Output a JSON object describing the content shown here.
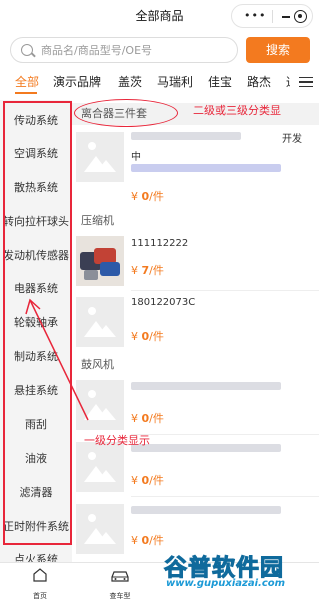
{
  "header": {
    "title": "全部商品"
  },
  "search": {
    "placeholder": "商品名/商品型号/OE号",
    "button_label": "搜索"
  },
  "tabs": [
    {
      "label": "全部",
      "active": true
    },
    {
      "label": "演示品牌"
    },
    {
      "label": "盖茨"
    },
    {
      "label": "马瑞利"
    },
    {
      "label": "佳宝"
    },
    {
      "label": "路杰"
    },
    {
      "label": "通"
    }
  ],
  "sidebar": {
    "items": [
      {
        "label": "传动系统"
      },
      {
        "label": "空调系统"
      },
      {
        "label": "散热系统"
      },
      {
        "label": "转向拉杆球头"
      },
      {
        "label": "发动机传感器"
      },
      {
        "label": "电器系统"
      },
      {
        "label": "轮毂轴承"
      },
      {
        "label": "制动系统"
      },
      {
        "label": "悬挂系统"
      },
      {
        "label": "雨刮"
      },
      {
        "label": "油液"
      },
      {
        "label": "滤清器"
      },
      {
        "label": "正时附件系统"
      },
      {
        "label": "点火系统"
      }
    ]
  },
  "content": {
    "groups": [
      {
        "title": "离合器三件套",
        "products": [
          {
            "title_tail": "开发",
            "title_line2": "中",
            "price": "0",
            "unit": "/件"
          }
        ]
      },
      {
        "title": "压缩机",
        "products": [
          {
            "title": "111112222",
            "price": "7",
            "unit": "/件"
          },
          {
            "title": "180122073C",
            "price": "0",
            "unit": "/件"
          }
        ]
      },
      {
        "title": "鼓风机",
        "products": [
          {
            "price": "0",
            "unit": "/件"
          },
          {
            "price": "0",
            "unit": "/件"
          },
          {
            "price": "0",
            "unit": "/件"
          }
        ]
      }
    ],
    "currency": "¥"
  },
  "annotations": {
    "level2": "二级或三级分类显",
    "level1": "一级分类显示",
    "color": "#e8263a"
  },
  "bottom_nav": [
    {
      "label": "首页",
      "icon": "home-icon"
    },
    {
      "label": "查车型",
      "icon": "car-icon"
    }
  ],
  "watermark": {
    "title": "谷普软件园",
    "url": "www.gupuxiazai.com"
  },
  "colors": {
    "accent": "#f37a1f",
    "sidebar_bg": "#f4f4f4"
  }
}
